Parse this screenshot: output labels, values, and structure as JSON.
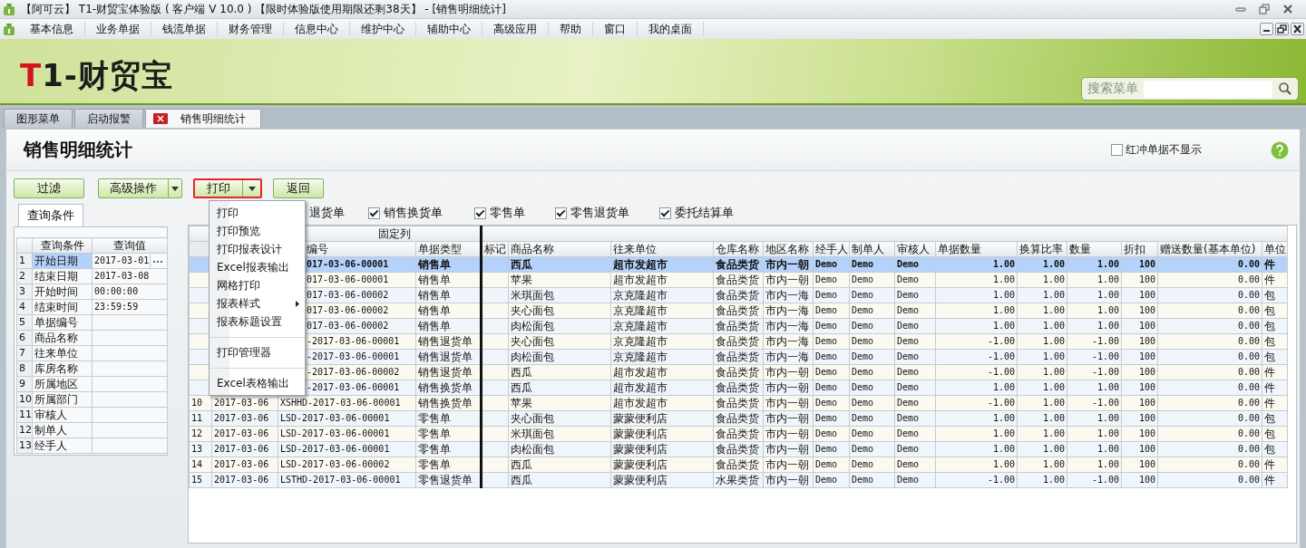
{
  "window": {
    "title": "【阿可云】 T1-财贸宝体验版 ( 客户端 V 10.0 ) 【限时体验版使用期限还剩38天】 - [销售明细统计]"
  },
  "menu_bar": {
    "items": [
      "基本信息",
      "业务单据",
      "钱流单据",
      "财务管理",
      "信息中心",
      "维护中心",
      "辅助中心",
      "高级应用",
      "帮助",
      "窗口",
      "我的桌面"
    ]
  },
  "banner": {
    "logo": {
      "mark": "T",
      "text": "1-财贸宝"
    },
    "search": {
      "label": "搜索菜单"
    }
  },
  "tabs": [
    {
      "label": "图形菜单",
      "selected": false,
      "closable": false
    },
    {
      "label": "启动报警",
      "selected": false,
      "closable": false
    },
    {
      "label": "销售明细统计",
      "selected": true,
      "closable": true
    }
  ],
  "page": {
    "title": "销售明细统计",
    "hide_red_reversal": {
      "label": "红冲单据不显示",
      "checked": false
    }
  },
  "toolbar": [
    {
      "label": "过滤",
      "kind": "plain",
      "highlighted": false
    },
    {
      "label": "高级操作",
      "kind": "split",
      "highlighted": false
    },
    {
      "label": "打印",
      "kind": "split",
      "highlighted": true
    },
    {
      "label": "返回",
      "kind": "plain",
      "highlighted": false
    }
  ],
  "query_panel": {
    "tab": "查询条件",
    "columns": [
      "查询条件",
      "查询值"
    ],
    "rows": [
      {
        "no": "1",
        "name": "开始日期",
        "value": "2017-03-01",
        "selected": true
      },
      {
        "no": "2",
        "name": "结束日期",
        "value": "2017-03-08",
        "selected": false
      },
      {
        "no": "3",
        "name": "开始时间",
        "value": "00:00:00",
        "selected": false
      },
      {
        "no": "4",
        "name": "结束时间",
        "value": "23:59:59",
        "selected": false
      },
      {
        "no": "5",
        "name": "单据编号",
        "selected": false
      },
      {
        "no": "6",
        "name": "商品名称",
        "selected": false
      },
      {
        "no": "7",
        "name": "往来单位",
        "selected": false
      },
      {
        "no": "8",
        "name": "库房名称",
        "selected": false
      },
      {
        "no": "9",
        "name": "所属地区",
        "selected": false
      },
      {
        "no": "10",
        "name": "所属部门",
        "selected": false
      },
      {
        "no": "11",
        "name": "审核人",
        "selected": false
      },
      {
        "no": "12",
        "name": "制单人",
        "selected": false
      },
      {
        "no": "13",
        "name": "经手人",
        "selected": false
      }
    ]
  },
  "filters": [
    {
      "kind": "partial",
      "label": "退货单"
    },
    {
      "kind": "check",
      "label": "销售换货单",
      "checked": true
    },
    {
      "kind": "check",
      "label": "零售单",
      "checked": true
    },
    {
      "kind": "check",
      "label": "零售退货单",
      "checked": true
    },
    {
      "kind": "check",
      "label": "委托结算单",
      "checked": true
    }
  ],
  "print_menu": [
    {
      "kind": "item",
      "label": "打印"
    },
    {
      "kind": "item",
      "label": "打印预览"
    },
    {
      "kind": "item",
      "label": "打印报表设计"
    },
    {
      "kind": "item",
      "label": "Excel报表输出"
    },
    {
      "kind": "item",
      "label": "网格打印"
    },
    {
      "kind": "submenu",
      "label": "报表样式"
    },
    {
      "kind": "item",
      "label": "报表标题设置"
    },
    {
      "kind": "separator"
    },
    {
      "kind": "item",
      "label": "打印管理器"
    },
    {
      "kind": "separator"
    },
    {
      "kind": "item",
      "label": "Excel表格输出"
    }
  ],
  "table": {
    "group_header": "固定列",
    "columns": [
      "编号",
      "单据类型",
      "标记",
      "商品名称",
      "往来单位",
      "仓库名称",
      "地区名称",
      "经手人",
      "制单人",
      "审核人",
      "单据数量",
      "换算比率",
      "数量",
      "折扣",
      "赠送数量(基本单位)",
      "单位"
    ],
    "rows": [
      {
        "selected": true,
        "cells": [
          "017-03-06-00001",
          "销售单",
          "",
          "西瓜",
          "超市发超市",
          "食品类货",
          "市内一朝",
          "Demo",
          "Demo",
          "Demo",
          "1.00",
          "1.00",
          "1.00",
          "100",
          "0.00",
          "件"
        ]
      },
      {
        "selected": false,
        "cells": [
          "017-03-06-00001",
          "销售单",
          "",
          "苹果",
          "超市发超市",
          "食品类货",
          "市内一朝",
          "Demo",
          "Demo",
          "Demo",
          "1.00",
          "1.00",
          "1.00",
          "100",
          "0.00",
          "件"
        ]
      },
      {
        "selected": false,
        "cells": [
          "017-03-06-00002",
          "销售单",
          "",
          "米琪面包",
          "京克隆超市",
          "食品类货",
          "市内一海",
          "Demo",
          "Demo",
          "Demo",
          "1.00",
          "1.00",
          "1.00",
          "100",
          "0.00",
          "包"
        ]
      },
      {
        "selected": false,
        "cells": [
          "017-03-06-00002",
          "销售单",
          "",
          "夹心面包",
          "京克隆超市",
          "食品类货",
          "市内一海",
          "Demo",
          "Demo",
          "Demo",
          "1.00",
          "1.00",
          "1.00",
          "100",
          "0.00",
          "包"
        ]
      },
      {
        "selected": false,
        "cells": [
          "017-03-06-00002",
          "销售单",
          "",
          "肉松面包",
          "京克隆超市",
          "食品类货",
          "市内一海",
          "Demo",
          "Demo",
          "Demo",
          "1.00",
          "1.00",
          "1.00",
          "100",
          "0.00",
          "包"
        ]
      },
      {
        "selected": false,
        "cells": [
          "-2017-03-06-00001",
          "销售退货单",
          "",
          "夹心面包",
          "京克隆超市",
          "食品类货",
          "市内一海",
          "Demo",
          "Demo",
          "Demo",
          "-1.00",
          "1.00",
          "-1.00",
          "100",
          "0.00",
          "包"
        ]
      },
      {
        "selected": false,
        "cells": [
          "-2017-03-06-00001",
          "销售退货单",
          "",
          "肉松面包",
          "京克隆超市",
          "食品类货",
          "市内一海",
          "Demo",
          "Demo",
          "Demo",
          "-1.00",
          "1.00",
          "-1.00",
          "100",
          "0.00",
          "包"
        ]
      },
      {
        "selected": false,
        "cells": [
          "-2017-03-06-00002",
          "销售退货单",
          "",
          "西瓜",
          "超市发超市",
          "食品类货",
          "市内一朝",
          "Demo",
          "Demo",
          "Demo",
          "-1.00",
          "1.00",
          "-1.00",
          "100",
          "0.00",
          "件"
        ]
      },
      {
        "selected": false,
        "cells": [
          "-2017-03-06-00001",
          "销售换货单",
          "",
          "西瓜",
          "超市发超市",
          "食品类货",
          "市内一朝",
          "Demo",
          "Demo",
          "Demo",
          "1.00",
          "1.00",
          "1.00",
          "100",
          "0.00",
          "件"
        ]
      },
      {
        "no": "10",
        "date": "2017-03-06",
        "selected": false,
        "cells": [
          "XSHHD-2017-03-06-00001",
          "销售换货单",
          "",
          "苹果",
          "超市发超市",
          "食品类货",
          "市内一朝",
          "Demo",
          "Demo",
          "Demo",
          "-1.00",
          "1.00",
          "-1.00",
          "100",
          "0.00",
          "件"
        ]
      },
      {
        "no": "11",
        "date": "2017-03-06",
        "selected": false,
        "cells": [
          "LSD-2017-03-06-00001",
          "零售单",
          "",
          "夹心面包",
          "蒙蒙便利店",
          "食品类货",
          "市内一朝",
          "Demo",
          "Demo",
          "Demo",
          "1.00",
          "1.00",
          "1.00",
          "100",
          "0.00",
          "包"
        ]
      },
      {
        "no": "12",
        "date": "2017-03-06",
        "selected": false,
        "cells": [
          "LSD-2017-03-06-00001",
          "零售单",
          "",
          "米琪面包",
          "蒙蒙便利店",
          "食品类货",
          "市内一朝",
          "Demo",
          "Demo",
          "Demo",
          "1.00",
          "1.00",
          "1.00",
          "100",
          "0.00",
          "包"
        ]
      },
      {
        "no": "13",
        "date": "2017-03-06",
        "selected": false,
        "cells": [
          "LSD-2017-03-06-00001",
          "零售单",
          "",
          "肉松面包",
          "蒙蒙便利店",
          "食品类货",
          "市内一朝",
          "Demo",
          "Demo",
          "Demo",
          "1.00",
          "1.00",
          "1.00",
          "100",
          "0.00",
          "包"
        ]
      },
      {
        "no": "14",
        "date": "2017-03-06",
        "selected": false,
        "cells": [
          "LSD-2017-03-06-00002",
          "零售单",
          "",
          "西瓜",
          "蒙蒙便利店",
          "食品类货",
          "市内一朝",
          "Demo",
          "Demo",
          "Demo",
          "1.00",
          "1.00",
          "1.00",
          "100",
          "0.00",
          "件"
        ]
      },
      {
        "no": "15",
        "date": "2017-03-06",
        "selected": false,
        "cells": [
          "LSTHD-2017-03-06-00001",
          "零售退货单",
          "",
          "西瓜",
          "蒙蒙便利店",
          "水果类货",
          "市内一朝",
          "Demo",
          "Demo",
          "Demo",
          "-1.00",
          "1.00",
          "-1.00",
          "100",
          "0.00",
          "件"
        ]
      }
    ]
  }
}
